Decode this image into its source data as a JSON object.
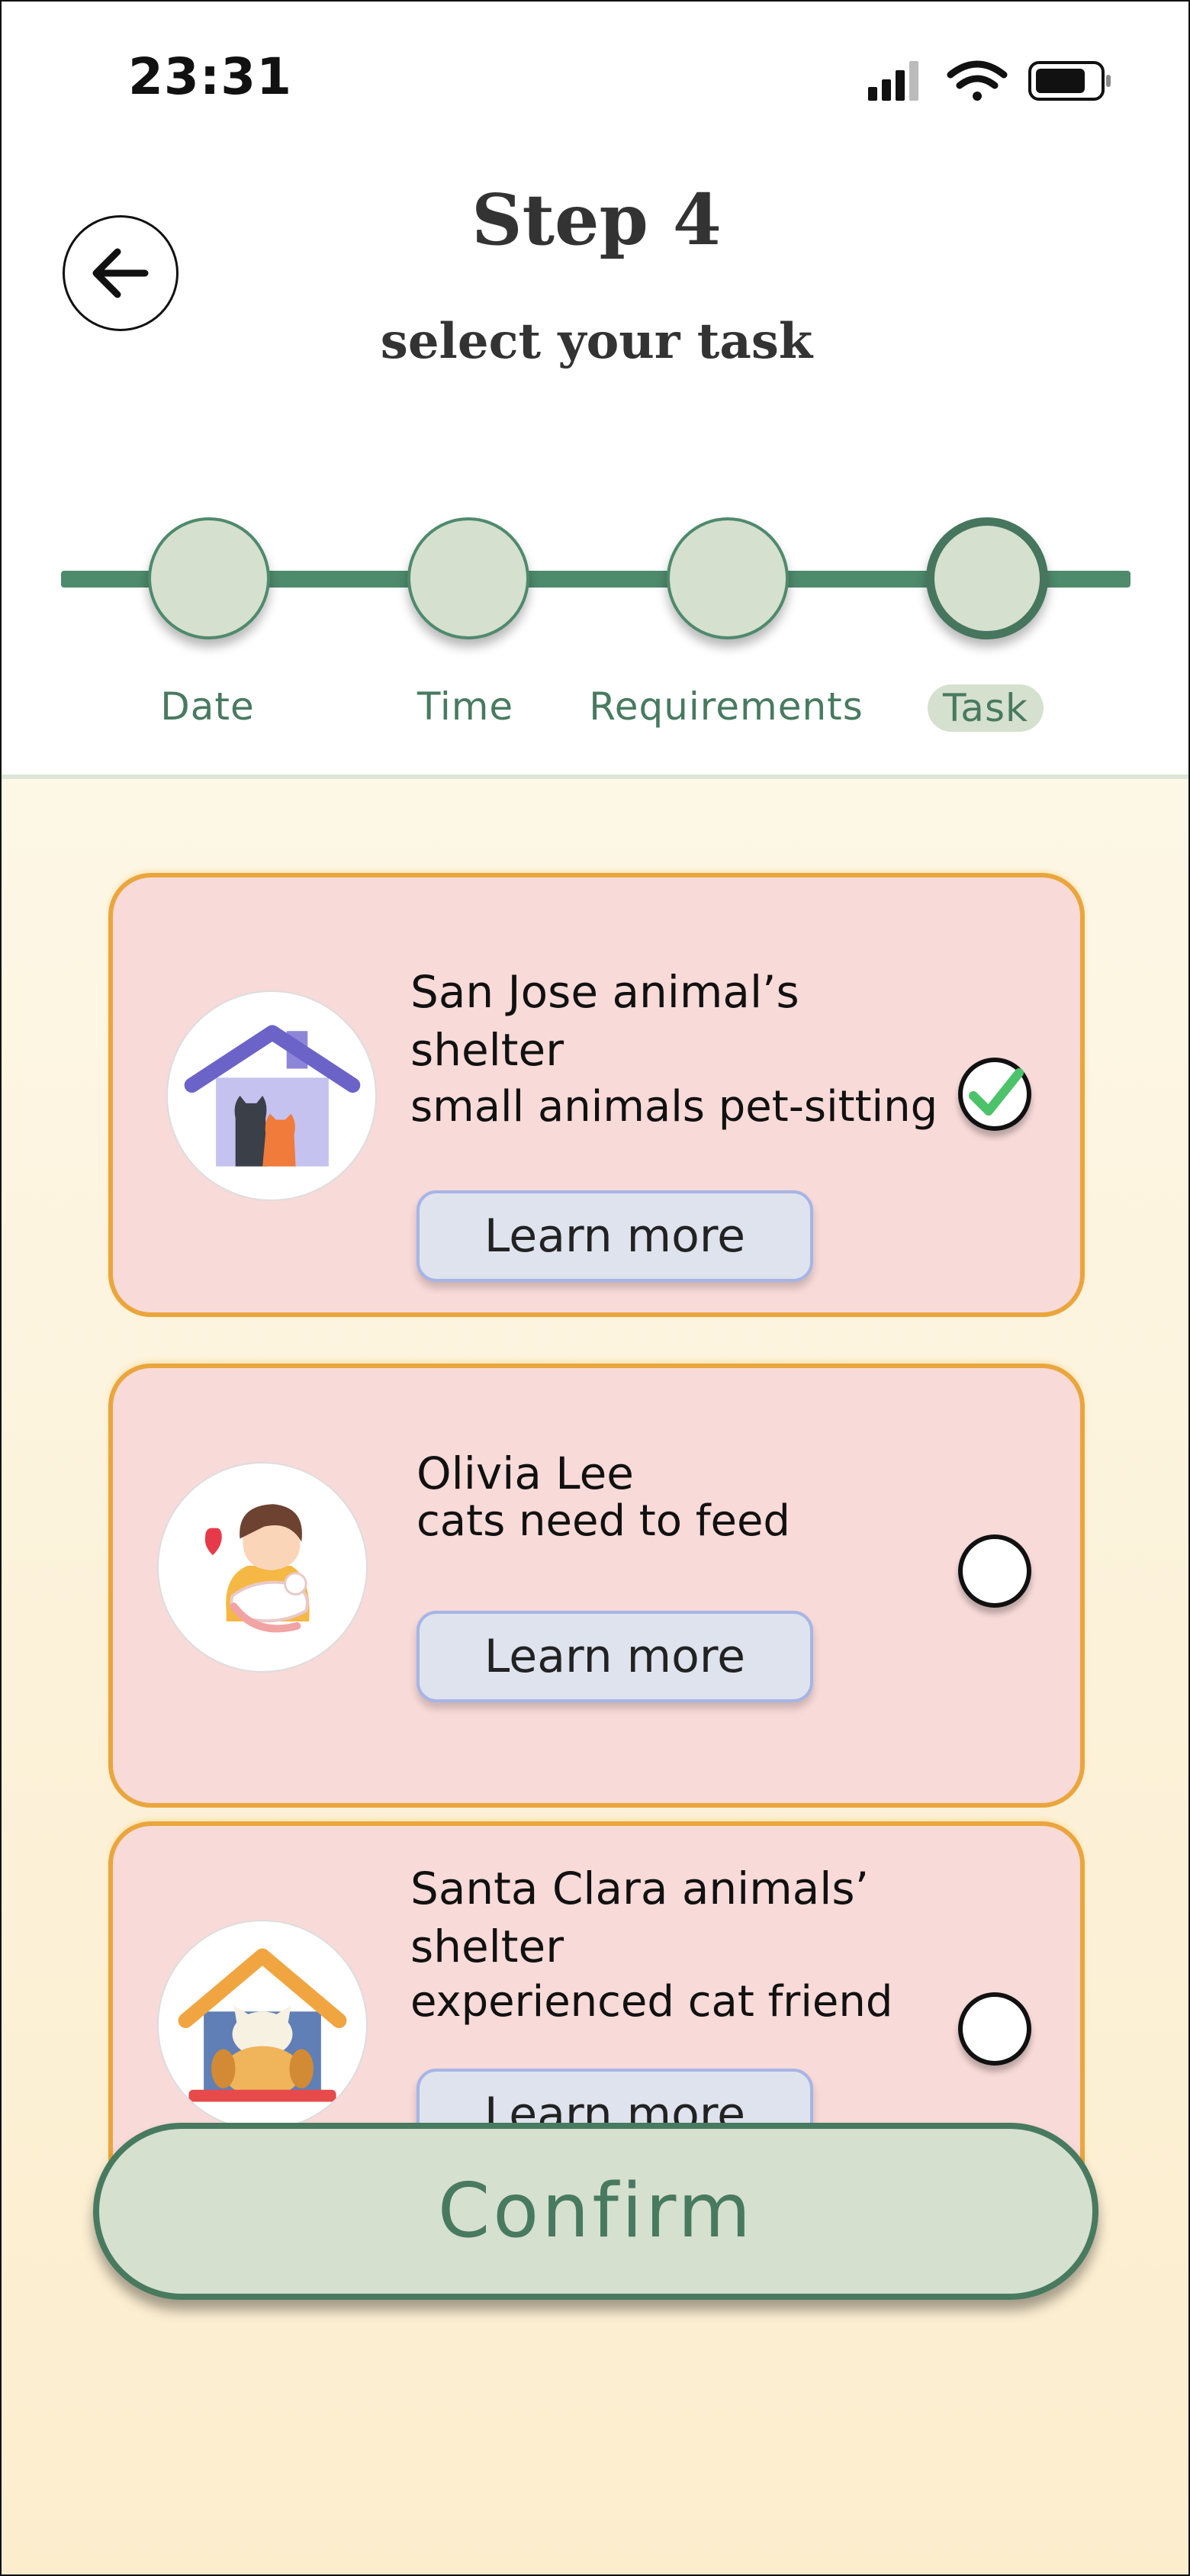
{
  "status_bar": {
    "time": "23:31"
  },
  "header": {
    "title": "Step 4",
    "subtitle": "select your task"
  },
  "progress": {
    "steps": [
      {
        "label": "Date"
      },
      {
        "label": "Time"
      },
      {
        "label": "Requirements"
      },
      {
        "label": "Task",
        "active": true
      }
    ]
  },
  "tasks": [
    {
      "title": "San Jose animal’s shelter",
      "description": "small animals pet-sitting",
      "button_label": "Learn more",
      "selected": true
    },
    {
      "title": "Olivia Lee",
      "description": "cats need to feed",
      "button_label": "Learn more",
      "selected": false
    },
    {
      "title": "Santa Clara animals’ shelter",
      "description": "experienced cat friend",
      "button_label": "Learn more",
      "selected": false
    }
  ],
  "confirm_label": "Confirm",
  "colors": {
    "accent_green": "#487a60",
    "card_bg": "#f8dad8",
    "card_border": "#eaa53d"
  }
}
